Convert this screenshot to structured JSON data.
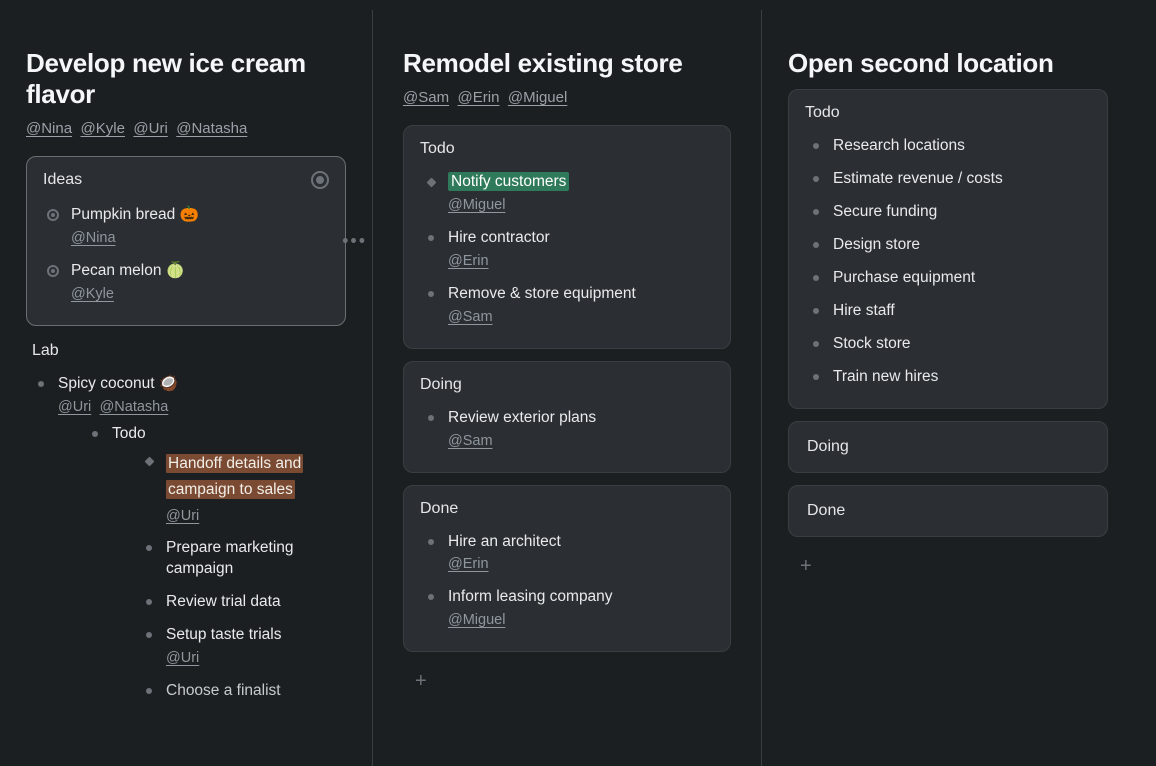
{
  "columns": [
    {
      "title": "Develop new ice cream flavor",
      "assignees": [
        "@Nina",
        "@Kyle",
        "@Uri",
        "@Natasha"
      ],
      "cards": [
        {
          "style": "selected",
          "title": "Ideas",
          "hasCornerRadio": true,
          "items": [
            {
              "bullet": "radio",
              "text": "Pumpkin bread 🎃",
              "assignees": [
                "@Nina"
              ]
            },
            {
              "bullet": "radio",
              "text": "Pecan melon 🍈",
              "assignees": [
                "@Kyle"
              ]
            }
          ],
          "kebab": true
        },
        {
          "style": "noborder",
          "title": "Lab",
          "items": [
            {
              "bullet": "dot",
              "text": "Spicy coconut 🥥",
              "assignees": [
                "@Uri",
                "@Natasha"
              ],
              "children": {
                "title": "Todo",
                "items": [
                  {
                    "bullet": "diamond",
                    "highlight": "orange",
                    "text": "Handoff details and campaign to sales",
                    "assignees": [
                      "@Uri"
                    ]
                  },
                  {
                    "bullet": "dot",
                    "text": "Prepare marketing campaign"
                  },
                  {
                    "bullet": "dot",
                    "text": "Review trial data"
                  },
                  {
                    "bullet": "dot",
                    "text": "Setup taste trials",
                    "assignees": [
                      "@Uri"
                    ]
                  },
                  {
                    "bullet": "dot",
                    "text": "Choose a finalist",
                    "dim": true
                  }
                ]
              }
            }
          ]
        }
      ]
    },
    {
      "title": "Remodel existing store",
      "assignees": [
        "@Sam",
        "@Erin",
        "@Miguel"
      ],
      "miniCards": [
        {
          "title": "Todo",
          "items": [
            {
              "bullet": "diamond",
              "highlight": "green",
              "text": "Notify customers",
              "assignees": [
                "@Miguel"
              ]
            },
            {
              "bullet": "dot",
              "text": "Hire contractor",
              "assignees": [
                "@Erin"
              ]
            },
            {
              "bullet": "dot",
              "text": "Remove & store equipment",
              "assignees": [
                "@Sam"
              ]
            }
          ]
        },
        {
          "title": "Doing",
          "items": [
            {
              "bullet": "dot",
              "text": "Review exterior plans",
              "assignees": [
                "@Sam"
              ]
            }
          ]
        },
        {
          "title": "Done",
          "items": [
            {
              "bullet": "dot",
              "text": "Hire an architect",
              "assignees": [
                "@Erin"
              ]
            },
            {
              "bullet": "dot",
              "text": "Inform leasing company",
              "assignees": [
                "@Miguel"
              ]
            }
          ]
        }
      ],
      "addBtn": "+"
    },
    {
      "title": "Open second location",
      "miniCards": [
        {
          "title": "Todo",
          "items": [
            {
              "bullet": "dot",
              "text": "Research locations"
            },
            {
              "bullet": "dot",
              "text": "Estimate revenue / costs"
            },
            {
              "bullet": "dot",
              "text": "Secure funding"
            },
            {
              "bullet": "dot",
              "text": "Design store"
            },
            {
              "bullet": "dot",
              "text": "Purchase equipment"
            },
            {
              "bullet": "dot",
              "text": "Hire staff"
            },
            {
              "bullet": "dot",
              "text": "Stock store"
            },
            {
              "bullet": "dot",
              "text": "Train new hires"
            }
          ]
        },
        {
          "title": "Doing",
          "empty": true
        },
        {
          "title": "Done",
          "empty": true
        }
      ],
      "addBtn": "+"
    }
  ]
}
